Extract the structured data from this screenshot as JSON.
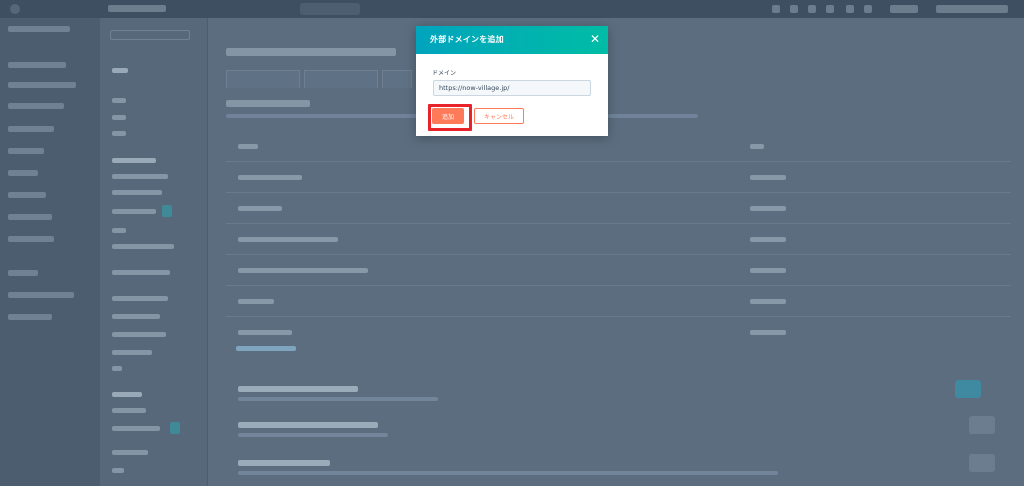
{
  "modal": {
    "title": "外部ドメインを追加",
    "close_icon": "close-icon",
    "domain_label": "ドメイン",
    "domain_value": "https://now-village.jp/",
    "add_label": "追加",
    "cancel_label": "キャンセル"
  },
  "colors": {
    "header_gradient_start": "#00a4bd",
    "header_gradient_end": "#00bda5",
    "primary_orange": "#ff7a59",
    "highlight_red": "#e8242a",
    "overlay": "#5b6d7f"
  }
}
